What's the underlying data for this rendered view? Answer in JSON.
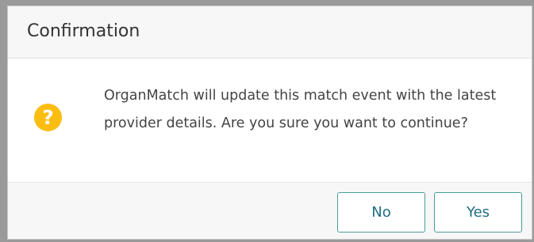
{
  "dialog": {
    "title": "Confirmation",
    "icon": "question-icon",
    "icon_glyph": "?",
    "icon_color": "#fbbd11",
    "message": "OrganMatch will update this match event with the latest provider details. Are you sure you want to continue?",
    "buttons": {
      "no_label": "No",
      "yes_label": "Yes"
    },
    "accent_color": "#1f6d80"
  }
}
